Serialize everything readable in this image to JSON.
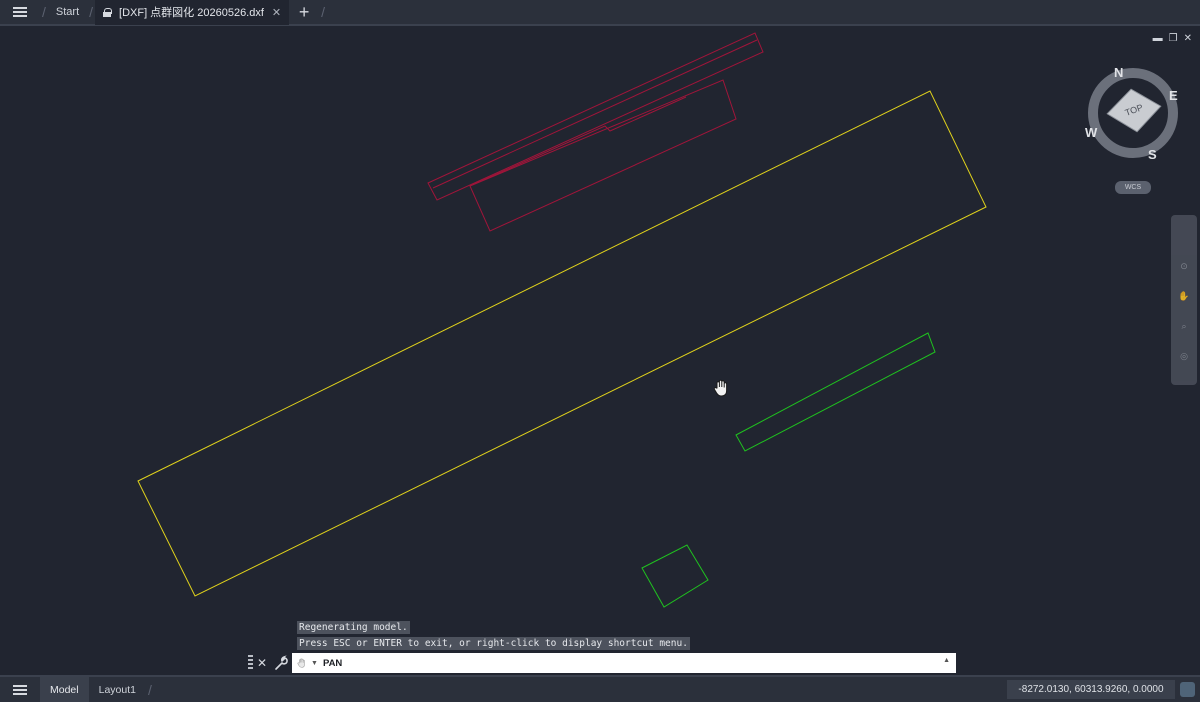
{
  "tabs": {
    "menu_icon": "hamburger-menu-icon",
    "start_label": "Start",
    "file_label": "[DXF] 点群図化 20260526.dxf",
    "close_glyph": "✕",
    "new_tab_glyph": "+"
  },
  "viewport_controls": {
    "minimize": "▬",
    "restore": "❐",
    "close": "✕"
  },
  "viewcube": {
    "top_label": "TOP",
    "north": "N",
    "east": "E",
    "south": "S",
    "west": "W",
    "wcs_label": "WCS"
  },
  "drawing": {
    "background": "#212530",
    "colors": {
      "yellow": "#e0d21c",
      "red": "#a0153a",
      "green": "#1fc21f"
    }
  },
  "command": {
    "history": [
      "Regenerating model.",
      "Press ESC or ENTER to exit, or right-click to display shortcut menu."
    ],
    "close_glyph": "✕",
    "current": "PAN"
  },
  "statusbar": {
    "model_tab": "Model",
    "layout_tab": "Layout1",
    "coordinates": "-8272.0130, 60313.9260, 0.0000"
  }
}
